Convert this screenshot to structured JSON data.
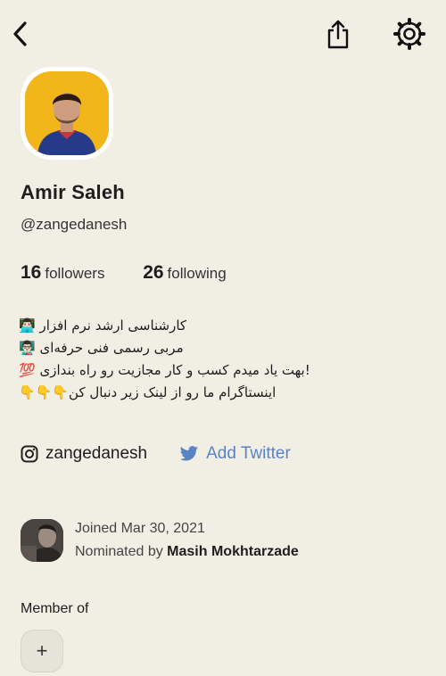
{
  "profile": {
    "name": "Amir Saleh",
    "handle": "@zangedanesh",
    "followers_count": "16",
    "followers_label": "followers",
    "following_count": "26",
    "following_label": "following"
  },
  "bio": {
    "line1": "👨🏻‍💻 کارشناسی ارشد نرم افزار",
    "line2": "👨🏻‍🏫 مربی رسمی فنی حرفه‌ای",
    "line3": "💯 بهت یاد میدم کسب و کار مجازیت رو راه بندازی!",
    "line4": "👇👇👇اینستاگرام  ما رو از لینک زیر دنبال کن"
  },
  "social": {
    "instagram": "zangedanesh",
    "twitter": "Add Twitter"
  },
  "joined": {
    "joined_text": "Joined Mar 30, 2021",
    "nominated_prefix": "Nominated by",
    "nominator": "Masih Mokhtarzade"
  },
  "membership": {
    "label": "Member of",
    "add_symbol": "+"
  },
  "icons": {
    "back": "chevron-left-icon",
    "share": "share-icon",
    "settings": "gear-icon",
    "instagram": "instagram-icon",
    "twitter": "twitter-bird-icon"
  },
  "colors": {
    "background": "#f1efe4",
    "twitter_accent": "#5a83c4",
    "avatar_background": "#f3b61a"
  }
}
